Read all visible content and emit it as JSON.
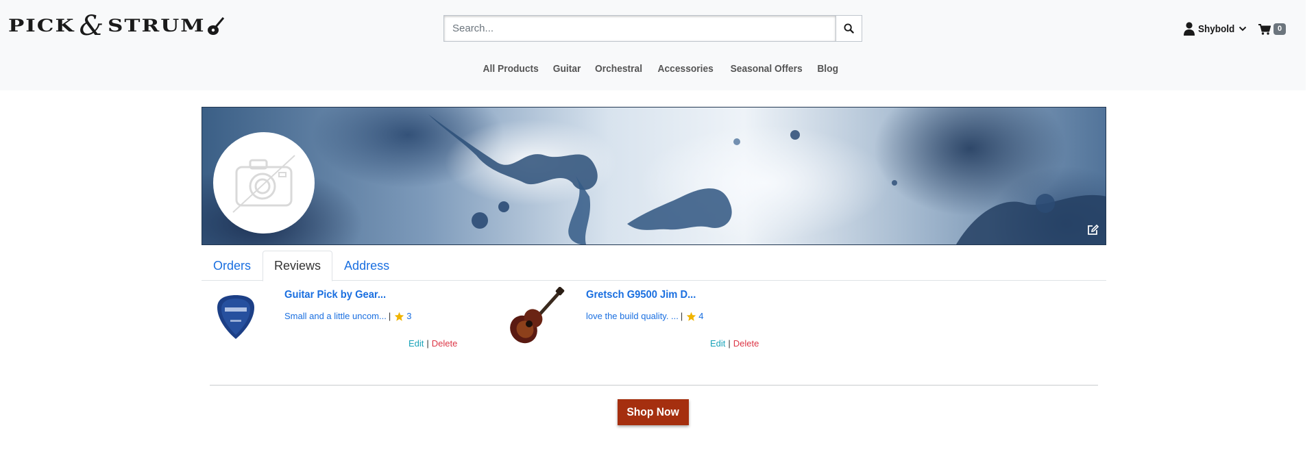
{
  "header": {
    "logo": {
      "part1": "PICK",
      "amp": "&",
      "part2": "STRUM"
    },
    "search": {
      "placeholder": "Search..."
    },
    "account": {
      "username": "Shybold"
    },
    "cart": {
      "count": "0"
    }
  },
  "nav": {
    "items": [
      {
        "label": "All Products"
      },
      {
        "label": "Guitar"
      },
      {
        "label": "Orchestral"
      },
      {
        "label": "Accessories"
      },
      {
        "label": "Seasonal Offers"
      },
      {
        "label": "Blog"
      }
    ]
  },
  "profile": {
    "tabs": [
      {
        "label": "Orders",
        "active": false
      },
      {
        "label": "Reviews",
        "active": true
      },
      {
        "label": "Address",
        "active": false
      }
    ],
    "reviews": [
      {
        "product": "Guitar Pick by Gear...",
        "excerpt": "Small and a little uncom...",
        "separator": "|",
        "rating": "3",
        "edit": "Edit",
        "delete": "Delete",
        "action_sep": "|"
      },
      {
        "product": "Gretsch G9500 Jim D...",
        "excerpt": "love the build quality. ...",
        "separator": "|",
        "rating": "4",
        "edit": "Edit",
        "delete": "Delete",
        "action_sep": "|"
      }
    ]
  },
  "cta": {
    "shop_now": "Shop Now"
  },
  "colors": {
    "link": "#1a6fe0",
    "edit": "#17a2b8",
    "delete": "#dc3545",
    "cta": "#a52f0f",
    "star": "#f0b400"
  }
}
